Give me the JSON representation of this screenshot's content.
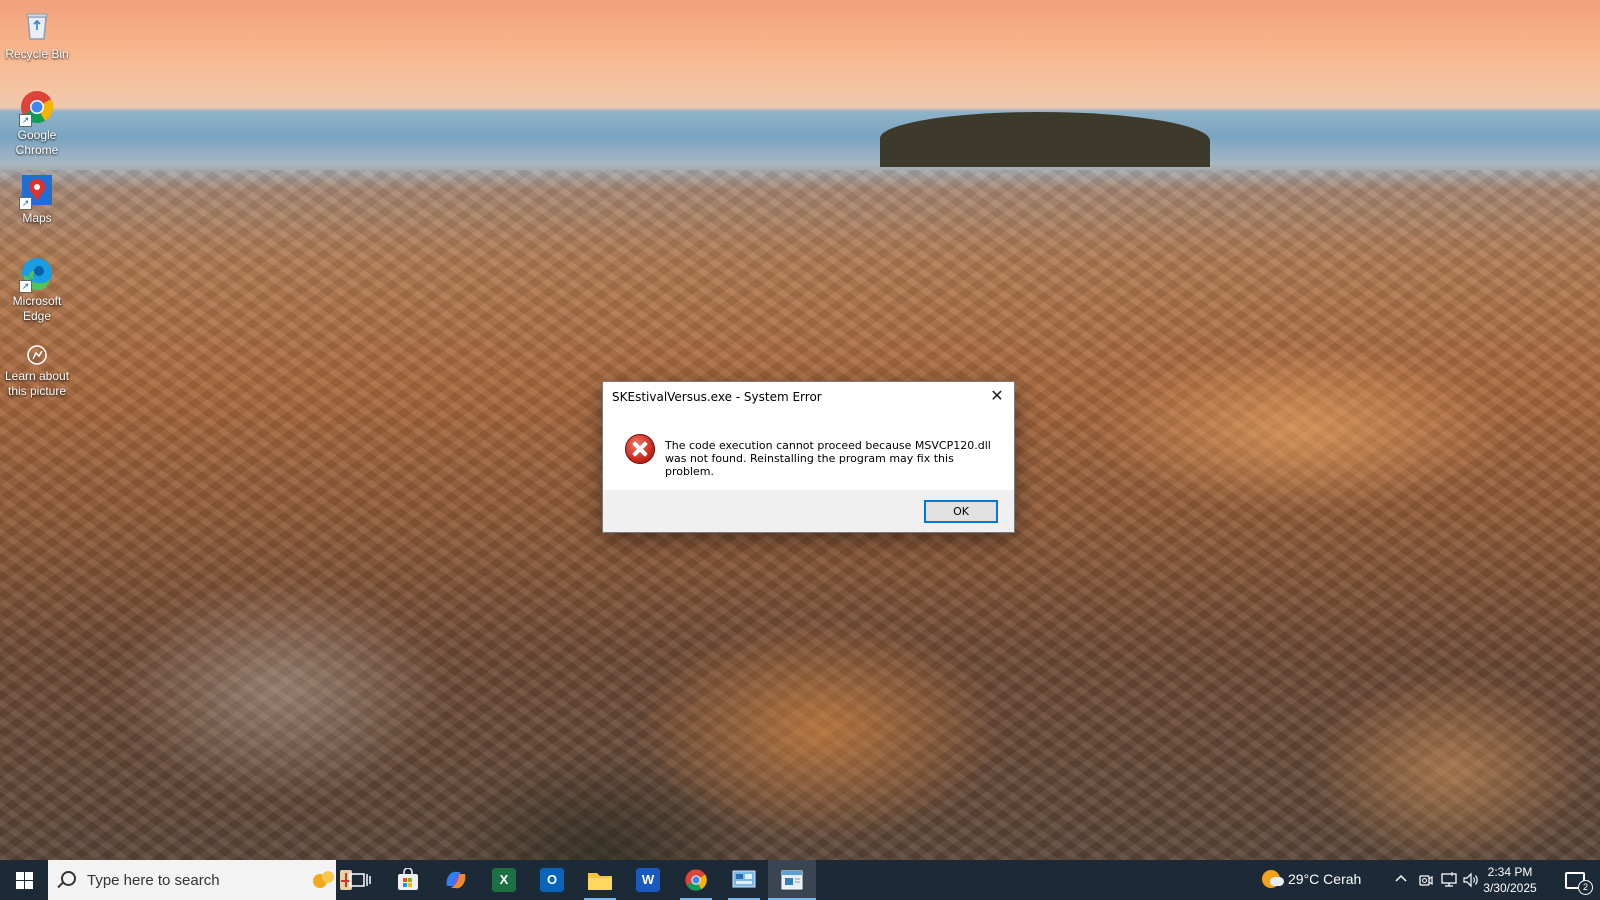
{
  "desktop": {
    "icons": [
      {
        "label": "Recycle Bin",
        "icon": "recycle-bin-icon"
      },
      {
        "label": "Google Chrome",
        "icon": "chrome-icon"
      },
      {
        "label": "Maps",
        "icon": "maps-icon"
      },
      {
        "label": "Microsoft Edge",
        "icon": "edge-icon"
      },
      {
        "label": "Learn about this picture",
        "icon": "learn-icon"
      }
    ]
  },
  "dialog": {
    "title": "SKEstivalVersus.exe - System Error",
    "close_glyph": "✕",
    "message_line1": "The code execution cannot proceed because MSVCP120.dll",
    "message_line2": "was not found. Reinstalling the program may fix this problem.",
    "ok_label": "OK",
    "icon": "error-icon"
  },
  "taskbar": {
    "search_placeholder": "Type here to search",
    "apps": [
      {
        "name": "task-view",
        "icon": "task-view-icon",
        "glyph": "❐"
      },
      {
        "name": "microsoft-store",
        "icon": "store-icon",
        "glyph": "▦"
      },
      {
        "name": "copilot",
        "icon": "copilot-icon",
        "glyph": ""
      },
      {
        "name": "excel",
        "icon": "excel-icon",
        "glyph": "X"
      },
      {
        "name": "outlook",
        "icon": "outlook-icon",
        "glyph": "O"
      },
      {
        "name": "file-explorer",
        "icon": "folder-icon",
        "glyph": ""
      },
      {
        "name": "word",
        "icon": "word-icon",
        "glyph": "W"
      },
      {
        "name": "chrome",
        "icon": "chrome-icon",
        "glyph": ""
      },
      {
        "name": "control-panel",
        "icon": "control-panel-icon",
        "glyph": ""
      },
      {
        "name": "skestival-app",
        "icon": "app-window-icon",
        "glyph": ""
      }
    ],
    "weather_text": "29°C  Cerah",
    "time": "2:34 PM",
    "date": "3/30/2025",
    "notification_count": "2"
  }
}
